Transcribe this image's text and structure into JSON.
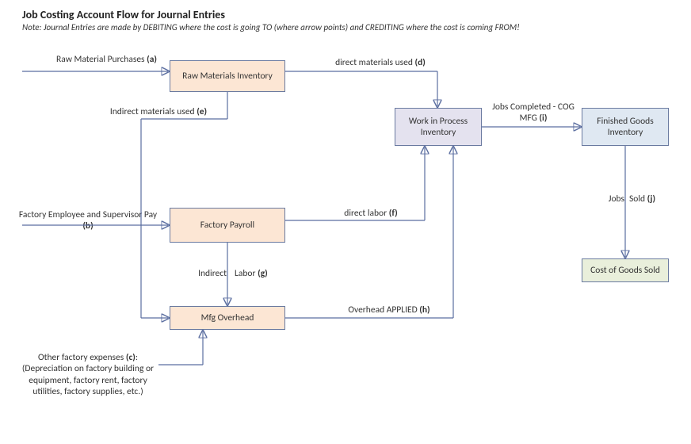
{
  "title": "Job Costing Account Flow for Journal Entries",
  "note": "Note:  Journal Entries are made by DEBITING where the cost is going TO (where arrow points) and CREDITING where the cost is coming FROM!",
  "boxes": {
    "raw_materials": "Raw Materials Inventory",
    "factory_payroll": "Factory Payroll",
    "mfg_overhead": "Mfg Overhead",
    "wip": "Work in Process Inventory",
    "finished_goods": "Finished Goods Inventory",
    "cogs": "Cost of Goods Sold"
  },
  "labels": {
    "a_pre": "Raw Material Purchases ",
    "a_tag": "(a)",
    "b_pre": "Factory Employee and Supervisor Pay ",
    "b_tag": "(b)",
    "c_pre": "Other factory expenses ",
    "c_tag": "(c)",
    "c_post": ":",
    "c_detail": "(Depreciation on factory building or equipment, factory rent, factory utilities, factory supplies, etc.)",
    "d_pre": "direct materials used ",
    "d_tag": "(d)",
    "e_pre": "Indirect materials used ",
    "e_tag": "(e)",
    "f_pre": "direct labor ",
    "f_tag": "(f)",
    "g_pre": "Indirect",
    "g_mid": "Labor ",
    "g_tag": "(g)",
    "h_pre": "Overhead APPLIED ",
    "h_tag": "(h)",
    "i_line1": "Jobs Completed - COG",
    "i_line2_pre": "MFG ",
    "i_tag": "(i)",
    "j_pre1": "Jobs",
    "j_pre2": "Sold ",
    "j_tag": "(j)"
  }
}
